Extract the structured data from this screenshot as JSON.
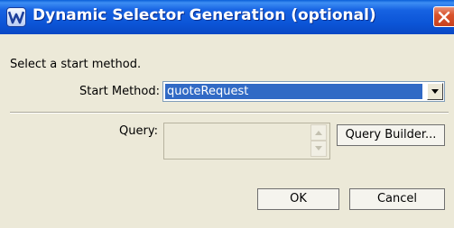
{
  "window": {
    "title": "Dynamic Selector Generation (optional)",
    "icons": {
      "app": "wsad-w-icon",
      "close": "close-x-icon"
    }
  },
  "form": {
    "prompt": "Select a start method.",
    "start_method_label": "Start Method:",
    "start_method_value": "quoteRequest",
    "query_label": "Query:",
    "query_value": ""
  },
  "buttons": {
    "query_builder": "Query Builder...",
    "ok": "OK",
    "cancel": "Cancel"
  },
  "colors": {
    "titlebar": "#0b54d6",
    "selection": "#316ac5",
    "dialog_bg": "#ece9d8",
    "close": "#d9532c"
  }
}
